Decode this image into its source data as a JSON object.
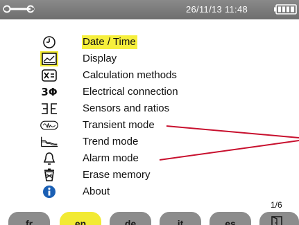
{
  "status_bar": {
    "datetime": "26/11/13 11:48"
  },
  "menu": {
    "items": [
      {
        "label": "Date / Time",
        "icon": "clock-icon",
        "selected": true
      },
      {
        "label": "Display",
        "icon": "display-icon",
        "selected": false
      },
      {
        "label": "Calculation methods",
        "icon": "calculation-icon",
        "selected": false
      },
      {
        "label": "Electrical connection",
        "icon": "three-phase-icon",
        "selected": false
      },
      {
        "label": "Sensors and ratios",
        "icon": "sensor-icon",
        "selected": false
      },
      {
        "label": "Transient mode",
        "icon": "transient-icon",
        "selected": false
      },
      {
        "label": "Trend mode",
        "icon": "trend-icon",
        "selected": false
      },
      {
        "label": "Alarm mode",
        "icon": "alarm-bell-icon",
        "selected": false
      },
      {
        "label": "Erase memory",
        "icon": "trash-icon",
        "selected": false
      },
      {
        "label": "About",
        "icon": "info-icon",
        "selected": false
      }
    ],
    "three_phase_symbol": "3Φ"
  },
  "language_tabs": [
    {
      "label": "fr",
      "active": false
    },
    {
      "label": "en",
      "active": true
    },
    {
      "label": "de",
      "active": false
    },
    {
      "label": "it",
      "active": false
    },
    {
      "label": "es",
      "active": false
    }
  ],
  "page_indicator": "1/6",
  "colors": {
    "selection_highlight": "#f6ef3c",
    "active_tab": "#f2ea33",
    "inactive_tab": "#8c8c8c",
    "status_bar": "#7a7a7a",
    "callout_line": "#c8102e",
    "info_icon": "#1a5fb4"
  }
}
